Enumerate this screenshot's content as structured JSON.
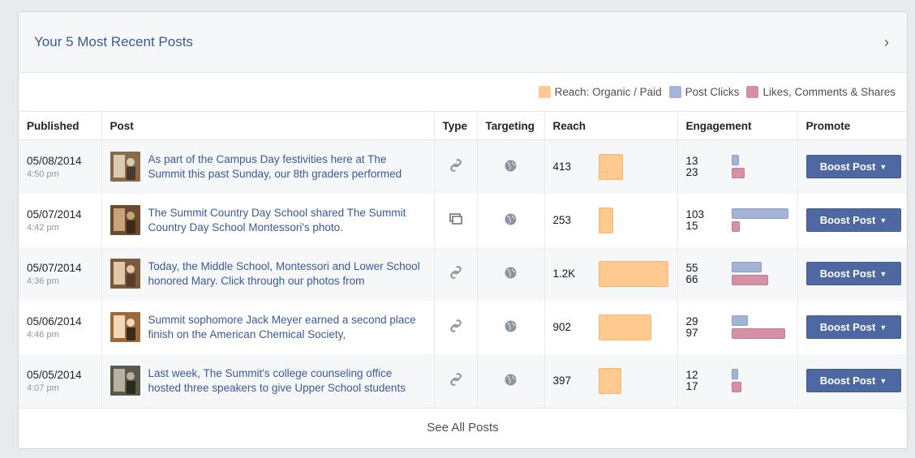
{
  "header": {
    "title": "Your 5 Most Recent Posts",
    "chevron": "›"
  },
  "legend": [
    {
      "label": "Reach: Organic / Paid",
      "color": "#ffc990"
    },
    {
      "label": "Post Clicks",
      "color": "#a3b4d6"
    },
    {
      "label": "Likes, Comments & Shares",
      "color": "#d590a4"
    }
  ],
  "columns": [
    "Published",
    "Post",
    "Type",
    "Targeting",
    "Reach",
    "Engagement",
    "Promote"
  ],
  "reach_max": 1200,
  "engagement_max": 103,
  "posts": [
    {
      "date": "05/08/2014",
      "time": "4:50 pm",
      "text": "As part of the Campus Day festivities here at The Summit this past Sunday, our 8th graders performed",
      "type_icon": "link-icon",
      "targeting_icon": "globe-icon",
      "reach_label": "413",
      "reach_value": 413,
      "clicks_label": "13",
      "clicks_value": 13,
      "likes_label": "23",
      "likes_value": 23,
      "boost_label": "Boost Post"
    },
    {
      "date": "05/07/2014",
      "time": "4:42 pm",
      "text": "The Summit Country Day School shared The Summit Country Day School Montessori's photo.",
      "type_icon": "shared-photo-icon",
      "targeting_icon": "globe-icon",
      "reach_label": "253",
      "reach_value": 253,
      "clicks_label": "103",
      "clicks_value": 103,
      "likes_label": "15",
      "likes_value": 15,
      "boost_label": "Boost Post"
    },
    {
      "date": "05/07/2014",
      "time": "4:36 pm",
      "text": "Today, the Middle School, Montessori and Lower School honored Mary. Click through our photos from",
      "type_icon": "link-icon",
      "targeting_icon": "globe-icon",
      "reach_label": "1.2K",
      "reach_value": 1200,
      "clicks_label": "55",
      "clicks_value": 55,
      "likes_label": "66",
      "likes_value": 66,
      "boost_label": "Boost Post"
    },
    {
      "date": "05/06/2014",
      "time": "4:46 pm",
      "text": "Summit sophomore Jack Meyer earned a second place finish on the American Chemical Society,",
      "type_icon": "link-icon",
      "targeting_icon": "globe-icon",
      "reach_label": "902",
      "reach_value": 902,
      "clicks_label": "29",
      "clicks_value": 29,
      "likes_label": "97",
      "likes_value": 97,
      "boost_label": "Boost Post"
    },
    {
      "date": "05/05/2014",
      "time": "4:07 pm",
      "text": "Last week, The Summit's college counseling office hosted three speakers to give Upper School students",
      "type_icon": "link-icon",
      "targeting_icon": "globe-icon",
      "reach_label": "397",
      "reach_value": 397,
      "clicks_label": "12",
      "clicks_value": 12,
      "likes_label": "17",
      "likes_value": 17,
      "boost_label": "Boost Post"
    }
  ],
  "footer": {
    "see_all": "See All Posts"
  }
}
